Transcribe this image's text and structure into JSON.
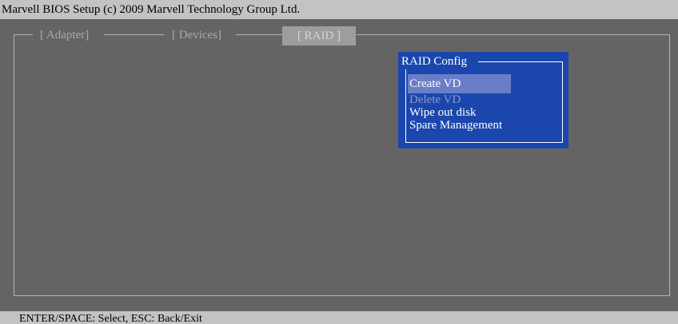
{
  "title_bar": {
    "text": "Marvell BIOS Setup (c) 2009 Marvell Technology Group Ltd."
  },
  "tabs": [
    {
      "label": "[ Adapter]",
      "active": false
    },
    {
      "label": "[ Devices]",
      "active": false
    },
    {
      "label": "[ RAID ]",
      "active": true
    }
  ],
  "raid_config": {
    "title": "RAID Config",
    "items": [
      {
        "label": "Create VD",
        "selected": true,
        "enabled": true
      },
      {
        "label": "Delete VD",
        "selected": false,
        "enabled": false
      },
      {
        "label": "Wipe out disk",
        "selected": false,
        "enabled": true
      },
      {
        "label": "Spare Management",
        "selected": false,
        "enabled": true
      }
    ]
  },
  "status_bar": {
    "text": "ENTER/SPACE: Select, ESC: Back/Exit"
  },
  "colors": {
    "background": "#666364",
    "bar": "#c3c3c3",
    "popup": "#1b46ad",
    "selection": "#6a7ec8",
    "disabled_text": "#8e9bc9",
    "active_tab": "#9d9d9d"
  }
}
